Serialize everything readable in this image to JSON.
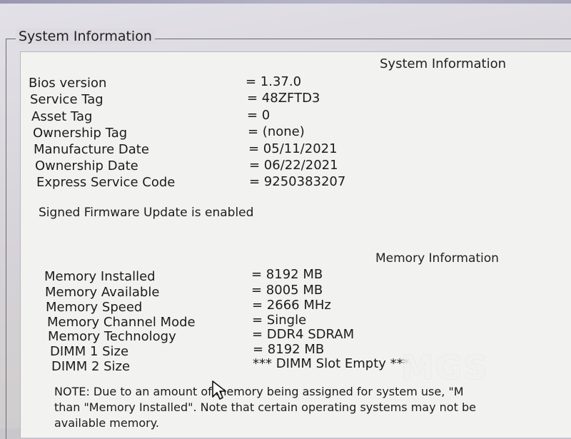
{
  "frame_title": "System Information",
  "system_section": {
    "heading": "System Information",
    "rows": [
      {
        "label": "Bios version",
        "value": "= 1.37.0"
      },
      {
        "label": "Service Tag",
        "value": "= 48ZFTD3"
      },
      {
        "label": "Asset Tag",
        "value": "= 0"
      },
      {
        "label": "Ownership Tag",
        "value": "= (none)"
      },
      {
        "label": "Manufacture Date",
        "value": "= 05/11/2021"
      },
      {
        "label": "Ownership Date",
        "value": "= 06/22/2021"
      },
      {
        "label": "Express Service Code",
        "value": "= 9250383207"
      }
    ],
    "notice": "Signed Firmware Update is enabled"
  },
  "memory_section": {
    "heading": "Memory Information",
    "rows": [
      {
        "label": "Memory Installed",
        "value": "= 8192 MB"
      },
      {
        "label": "Memory Available",
        "value": "= 8005 MB"
      },
      {
        "label": "Memory Speed",
        "value": "= 2666 MHz"
      },
      {
        "label": "Memory Channel Mode",
        "value": "= Single"
      },
      {
        "label": "Memory Technology",
        "value": "= DDR4 SDRAM"
      },
      {
        "label": "DIMM 1 Size",
        "value": "= 8192 MB"
      },
      {
        "label": "DIMM 2 Size",
        "value": "*** DIMM Slot Empty ***"
      }
    ]
  },
  "note": {
    "line1": "NOTE: Due to an amount of memory being assigned for system use, \"M",
    "line2": "than \"Memory Installed\". Note that certain operating systems may not be",
    "line3": "available memory."
  },
  "watermark": {
    "text": "MGS"
  }
}
